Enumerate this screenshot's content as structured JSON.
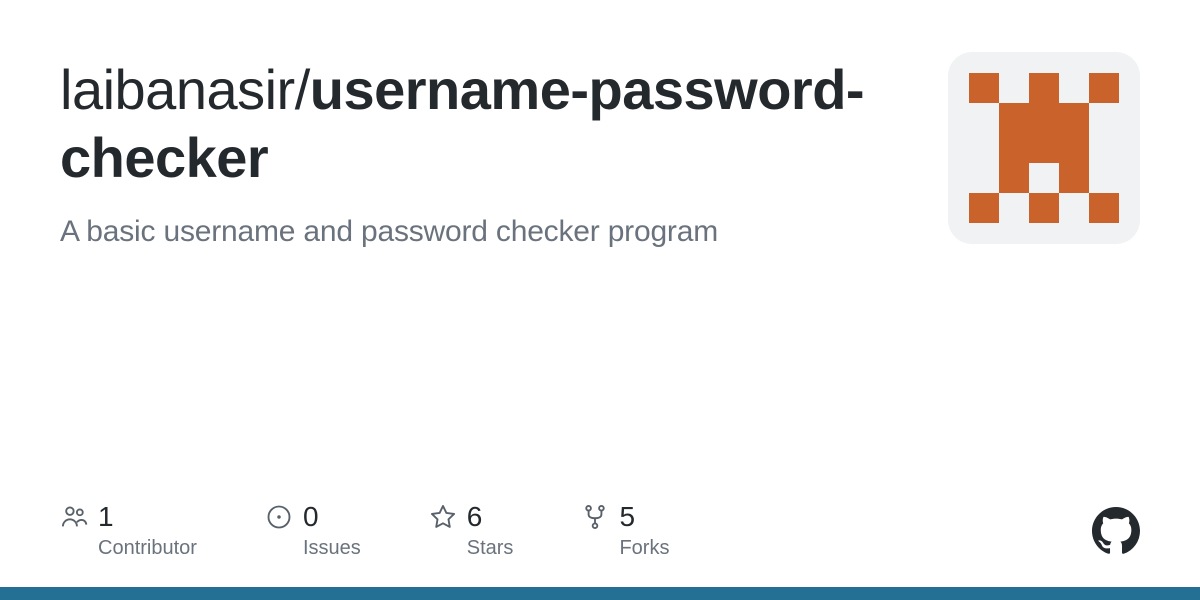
{
  "repo": {
    "owner": "laibanasir",
    "slash": "/",
    "name_bold": "username",
    "name_dash1": "-",
    "name_bold2": "password",
    "name_dash2": "-",
    "name_rest": "checker"
  },
  "description": "A basic username and password checker program",
  "stats": {
    "contributors": {
      "count": "1",
      "label": "Contributor"
    },
    "issues": {
      "count": "0",
      "label": "Issues"
    },
    "stars": {
      "count": "6",
      "label": "Stars"
    },
    "forks": {
      "count": "5",
      "label": "Forks"
    }
  },
  "colors": {
    "accent_bar": "#247094",
    "identicon": "#c9622b"
  }
}
